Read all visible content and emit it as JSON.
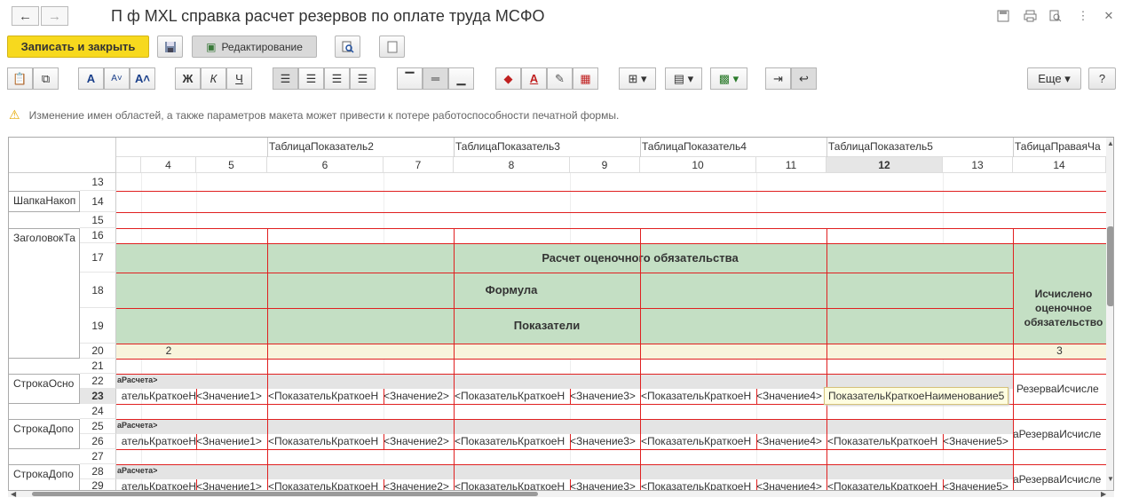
{
  "window": {
    "title": "П ф MXL справка расчет резервов по оплате труда МСФО",
    "back_icon": "←",
    "forward_icon": "→"
  },
  "toolbar": {
    "save_close": "Записать и закрыть",
    "editing": "Редактирование",
    "more": "Еще",
    "help": "?",
    "buttons": [
      {
        "name": "paste-icon",
        "glyph": "📋"
      },
      {
        "name": "copy-icon",
        "glyph": "⧉"
      },
      {
        "name": "font-icon",
        "glyph": "A"
      },
      {
        "name": "font-decrease-icon",
        "glyph": "Aˇ"
      },
      {
        "name": "font-increase-icon",
        "glyph": "Aˆ"
      },
      {
        "name": "bold-button",
        "glyph": "Ж"
      },
      {
        "name": "italic-button",
        "glyph": "К"
      },
      {
        "name": "underline-button",
        "glyph": "Ч"
      },
      {
        "name": "align-left-icon",
        "glyph": "≡"
      },
      {
        "name": "align-center-icon",
        "glyph": "≡"
      },
      {
        "name": "align-right-icon",
        "glyph": "≡"
      },
      {
        "name": "justify-icon",
        "glyph": "≣"
      },
      {
        "name": "valign-top-icon",
        "glyph": "▔"
      },
      {
        "name": "valign-middle-icon",
        "glyph": "═"
      },
      {
        "name": "valign-bottom-icon",
        "glyph": "▁"
      },
      {
        "name": "fill-color-icon",
        "glyph": "◆"
      },
      {
        "name": "text-color-icon",
        "glyph": "A"
      },
      {
        "name": "pen-icon",
        "glyph": "✎"
      },
      {
        "name": "clear-format-icon",
        "glyph": "▦"
      },
      {
        "name": "borders-icon",
        "glyph": "⊞▾"
      },
      {
        "name": "table-icon",
        "glyph": "▤▾"
      },
      {
        "name": "picture-icon",
        "glyph": "▩▾"
      },
      {
        "name": "arrow-right-icon",
        "glyph": "⇥"
      },
      {
        "name": "wrap-icon",
        "glyph": "↩"
      }
    ]
  },
  "warning": "Изменение имен областей, а также параметров макета может привести к потере работоспособности печатной формы.",
  "grid": {
    "col_groups": [
      "ТаблицаПоказатель2",
      "ТаблицаПоказатель3",
      "ТаблицаПоказатель4",
      "ТаблицаПоказатель5",
      "ТабицаПраваяЧа"
    ],
    "col_numbers": [
      "4",
      "5",
      "6",
      "7",
      "8",
      "9",
      "10",
      "11",
      "12",
      "13",
      "14"
    ],
    "rows": [
      "13",
      "14",
      "15",
      "16",
      "17",
      "18",
      "19",
      "20",
      "21",
      "22",
      "23",
      "24",
      "25",
      "26",
      "27",
      "28",
      "29"
    ],
    "areas": [
      "ШапкаНакоп",
      "ЗаголовокТа",
      "СтрокаОсно",
      "СтрокаДопо",
      "СтрокаДопо"
    ],
    "header_texts": {
      "calc": "Расчет оценочного обязательства",
      "formula": "Формула",
      "indicators": "Показатели",
      "computed": "Исчислено оценочное обязательство",
      "num2": "2",
      "num3": "3"
    },
    "row22_label": "аРасчета>",
    "row23": {
      "c4": "ательКраткоеН",
      "c5": "<Значение1>",
      "c6": "<ПоказательКраткоеН",
      "c7": "<Значение2>",
      "c8": "<ПоказательКраткоеН",
      "c9": "<Значение3>",
      "c10": "<ПоказательКраткоеН",
      "c11": "<Значение4>",
      "c12": "ПоказательКраткоеНаименование5",
      "c14": "РезерваИсчисле"
    },
    "row26": {
      "c4": "ательКраткоеН",
      "c5": "<Значение1>",
      "c6": "<ПоказательКраткоеН",
      "c7": "<Значение2>",
      "c8": "<ПоказательКраткоеН",
      "c9": "<Значение3>",
      "c10": "<ПоказательКраткоеН",
      "c11": "<Значение4>",
      "c12": "<ПоказательКраткоеН",
      "c13": "<Значение5>",
      "c14": "аРезерваИсчисле"
    },
    "row29": {
      "c4": "ательКраткоеН",
      "c5": "<Значение1>",
      "c6": "<ПоказательКраткоеН",
      "c7": "<Значение2>",
      "c8": "<ПоказательКраткоеН",
      "c9": "<Значение3>",
      "c10": "<ПоказательКраткоеН",
      "c11": "<Значение4>",
      "c12": "<ПоказательКраткоеН",
      "c13": "<Значение5>",
      "c14": "аРезерваИсчисле"
    }
  }
}
